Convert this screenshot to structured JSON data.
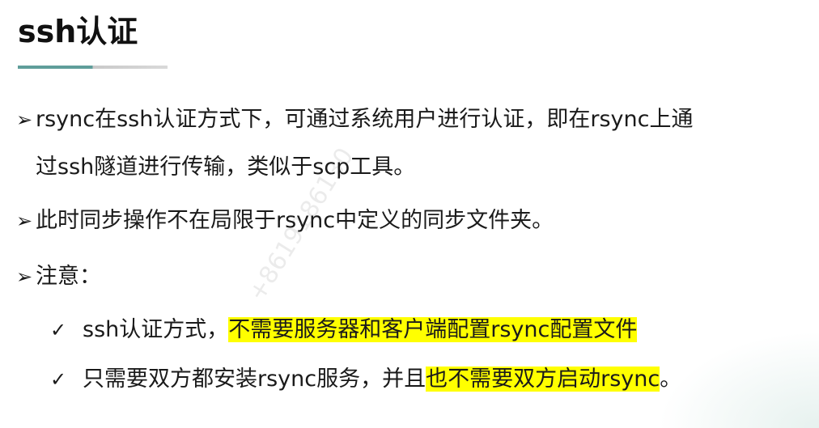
{
  "title": "ssh认证",
  "bullets": [
    {
      "marker": "➢",
      "line1": "rsync在ssh认证方式下，可通过系统用户进行认证，即在rsync上通",
      "line2": "过ssh隧道进行传输，类似于scp工具。"
    },
    {
      "marker": "➢",
      "text": "此时同步操作不在局限于rsync中定义的同步文件夹。"
    },
    {
      "marker": "➢",
      "text": "注意："
    }
  ],
  "subitems": [
    {
      "marker": "✓",
      "plain": "ssh认证方式，",
      "highlight": "不需要服务器和客户端配置rsync配置文件",
      "tail": ""
    },
    {
      "marker": "✓",
      "plain": "只需要双方都安装rsync服务，并且",
      "highlight": "也不需要双方启动rsync",
      "tail": "。"
    }
  ],
  "watermark": "+8619186130",
  "colors": {
    "highlight": "#ffff00",
    "title_bar": "#5f9e9a"
  }
}
